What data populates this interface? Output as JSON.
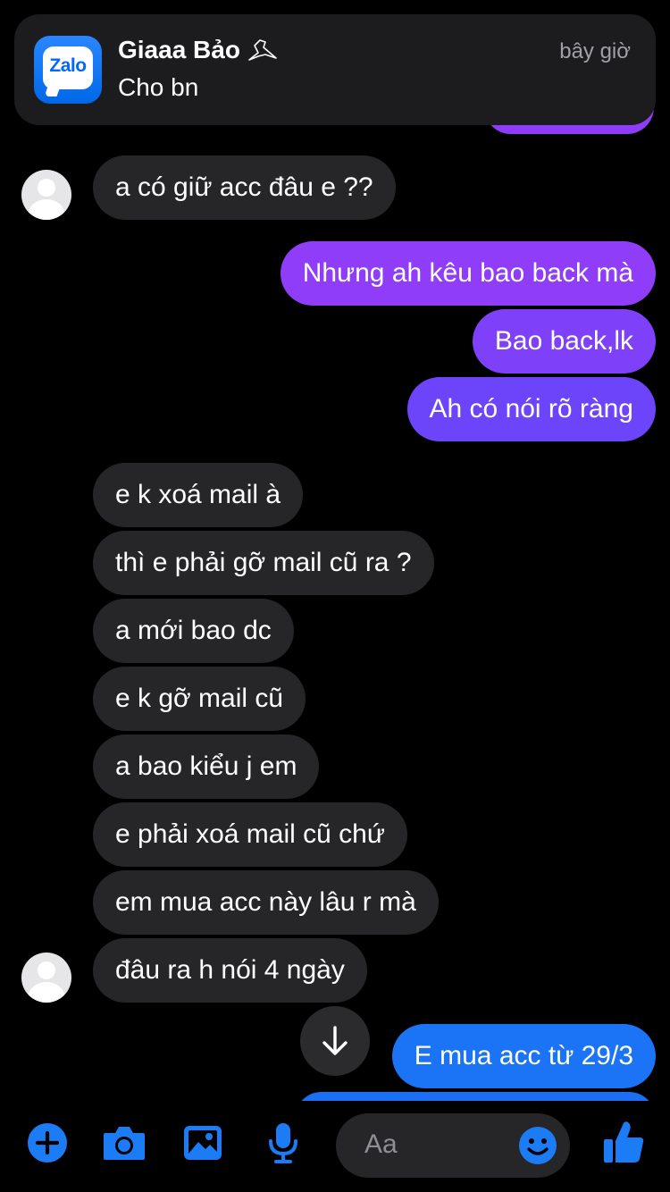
{
  "notification": {
    "app_name": "Zalo",
    "sender": "Giaaa Bảo",
    "message": "Cho bn",
    "time": "bây giờ"
  },
  "messages": [
    {
      "dir": "in",
      "text": "a có giữ acc đâu e ??"
    },
    {
      "dir": "out",
      "text": "Nhưng ah kêu bao back mà"
    },
    {
      "dir": "out",
      "text": "Bao back,lk"
    },
    {
      "dir": "out",
      "text": "Ah có nói rõ ràng"
    },
    {
      "dir": "in",
      "text": "e k xoá mail à"
    },
    {
      "dir": "in",
      "text": "thì e phải gỡ mail cũ ra ?"
    },
    {
      "dir": "in",
      "text": "a mới bao dc"
    },
    {
      "dir": "in",
      "text": "e k gỡ mail cũ"
    },
    {
      "dir": "in",
      "text": "a bao kiểu j em"
    },
    {
      "dir": "in",
      "text": "e phải xoá mail cũ chứ"
    },
    {
      "dir": "in",
      "text": "em mua acc này lâu r mà"
    },
    {
      "dir": "in",
      "text": "đâu ra h nói 4 ngày"
    },
    {
      "dir": "out",
      "text": "E mua acc từ 29/3"
    }
  ],
  "composer": {
    "placeholder": "Aa",
    "icons": [
      "plus-icon",
      "camera-icon",
      "image-icon",
      "microphone-icon",
      "emoji-icon",
      "like-icon"
    ]
  },
  "colors": {
    "background": "#000000",
    "incoming_bubble": "#262629",
    "outgoing_purple": "#8e3cf7",
    "outgoing_violet": "#6c45fb",
    "outgoing_blue": "#1b74f5",
    "accent": "#1b7cf5"
  }
}
